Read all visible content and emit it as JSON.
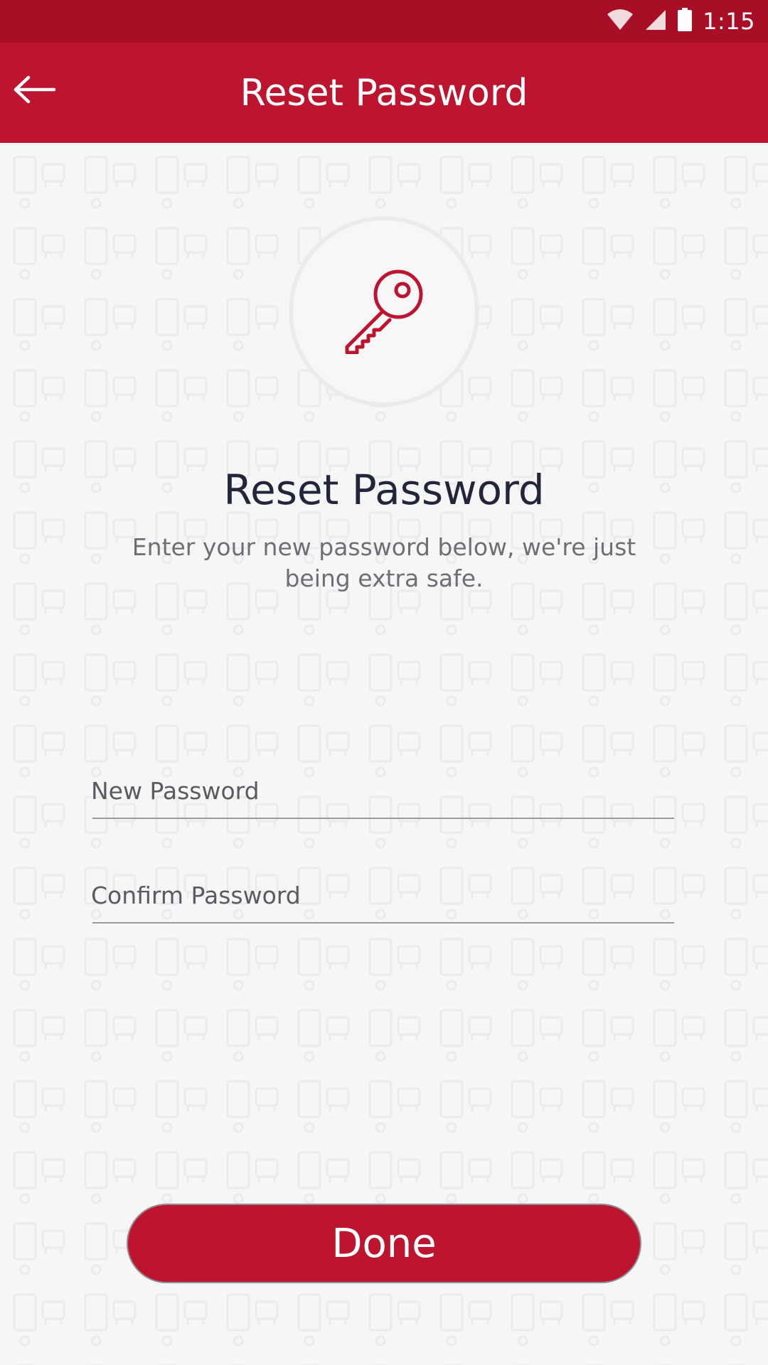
{
  "status_bar": {
    "time": "1:15",
    "icons": [
      "wifi-icon",
      "cell-signal-icon",
      "battery-icon"
    ],
    "background_color": "#a80f27"
  },
  "app_bar": {
    "title": "Reset Password",
    "back_icon": "arrow-left-icon",
    "background_color": "#bd1530"
  },
  "hero": {
    "icon": "key-icon",
    "icon_color": "#bd1530"
  },
  "content": {
    "heading": "Reset Password",
    "subtitle": "Enter your new password below, we're just being extra safe."
  },
  "form": {
    "new_password": {
      "placeholder": "New Password",
      "value": ""
    },
    "confirm_password": {
      "placeholder": "Confirm Password",
      "value": ""
    }
  },
  "actions": {
    "done_label": "Done"
  },
  "colors": {
    "accent": "#bd1530",
    "background": "#f6f6f7",
    "heading_text": "#23253a",
    "body_text": "#6e6e74"
  }
}
